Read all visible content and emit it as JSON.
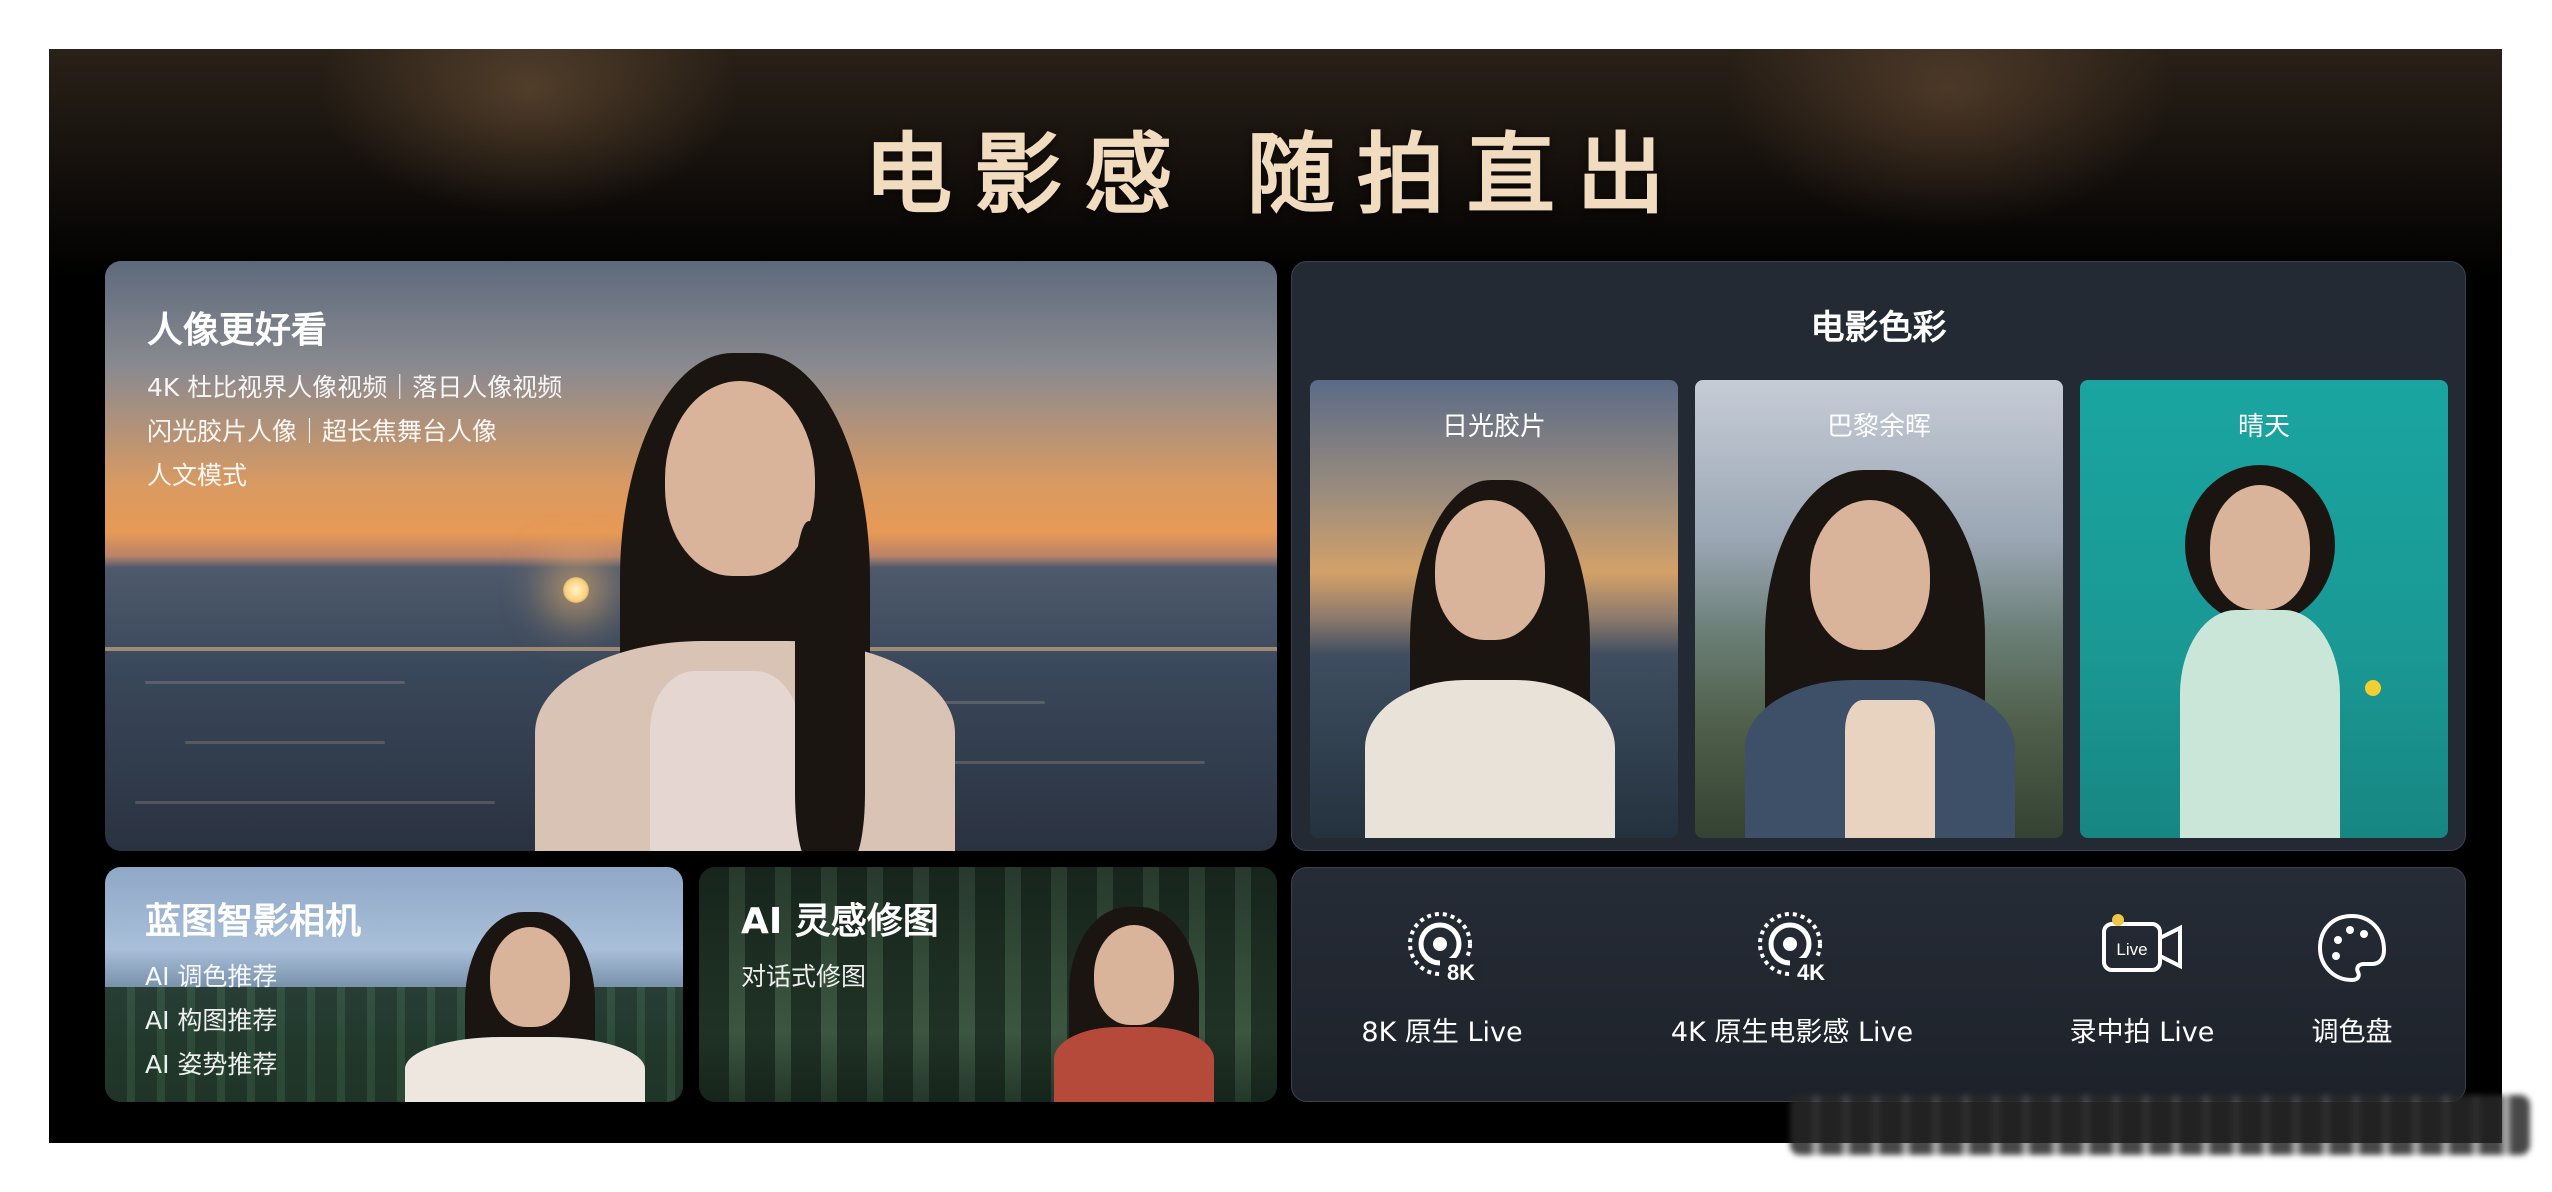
{
  "headline": "电影感  随拍直出",
  "portrait": {
    "title": "人像更好看",
    "lines": [
      "4K 杜比视界人像视频｜落日人像视频",
      "闪光胶片人像｜超长焦舞台人像",
      "人文模式"
    ]
  },
  "film_color": {
    "title": "电影色彩",
    "swatches": [
      {
        "label": "日光胶片",
        "accent": "#c88a4a"
      },
      {
        "label": "巴黎余晖",
        "accent": "#7b8a9a"
      },
      {
        "label": "晴天",
        "accent": "#1f9e9a"
      }
    ]
  },
  "blueprint": {
    "title": "蓝图智影相机",
    "lines": [
      "AI 调色推荐",
      "AI 构图推荐",
      "AI 姿势推荐"
    ]
  },
  "ai_edit": {
    "title": "AI 灵感修图",
    "lines": [
      "对话式修图"
    ]
  },
  "features": [
    {
      "icon": "live-8k-icon",
      "badge": "8K",
      "label": "8K 原生 Live"
    },
    {
      "icon": "live-4k-icon",
      "badge": "4K",
      "label": "4K 原生电影感 Live"
    },
    {
      "icon": "live-record-icon",
      "badge": "Live",
      "label": "录中拍 Live"
    },
    {
      "icon": "palette-icon",
      "badge": "",
      "label": "调色盘"
    }
  ],
  "colors": {
    "headline": "#f2dcc0",
    "panel": "#242a33",
    "accent_gold": "#f0c64a"
  }
}
